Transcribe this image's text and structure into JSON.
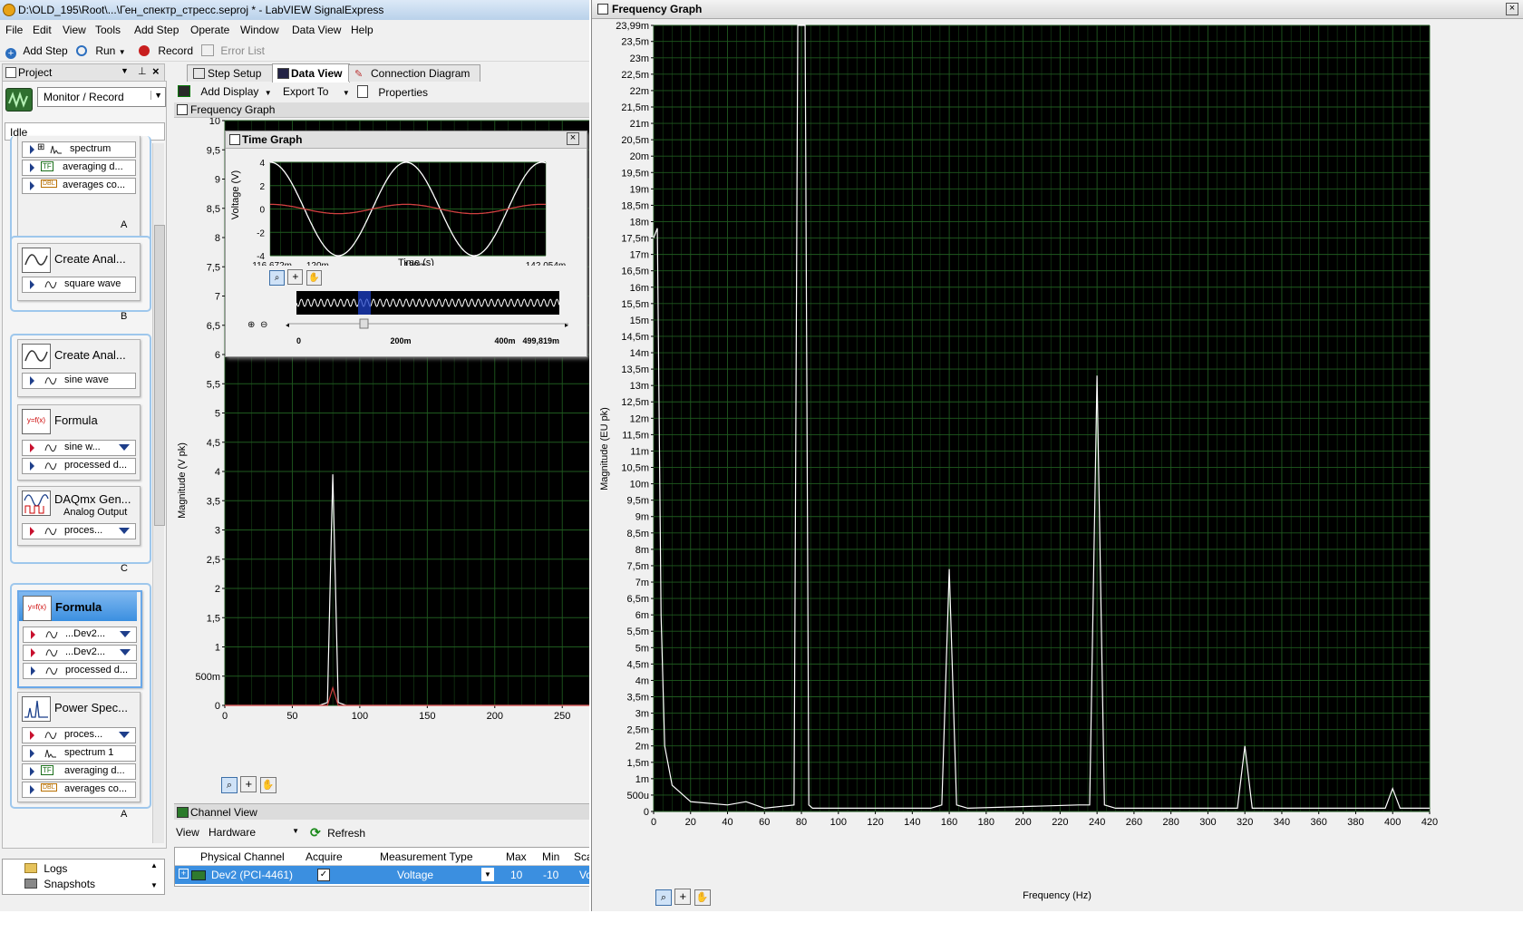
{
  "window": {
    "title": "D:\\OLD_195\\Root\\...\\Ген_спектр_стресс.seproj * - LabVIEW SignalExpress"
  },
  "menu": [
    "File",
    "Edit",
    "View",
    "Tools",
    "Add Step",
    "Operate",
    "Window",
    "Data View",
    "Help"
  ],
  "toolbar": {
    "add_step": "Add Step",
    "run": "Run",
    "record": "Record",
    "error_list": "Error List"
  },
  "project": {
    "title": "Project",
    "mode": "Monitor / Record",
    "status": "Idle",
    "groups": [
      {
        "letter": "A",
        "rows": [
          "spectrum",
          "averaging d...",
          "averages co..."
        ]
      },
      {
        "letter": "B",
        "title": "Create Anal...",
        "rows": [
          "square wave"
        ]
      },
      {
        "letter": "C",
        "steps": [
          {
            "title": "Create Anal...",
            "rows": [
              "sine wave"
            ]
          },
          {
            "title": "Formula",
            "rows": [
              "sine w...",
              "processed d..."
            ]
          },
          {
            "title": "DAQmx Gen...",
            "subtitle": "Analog Output",
            "rows": [
              "proces..."
            ]
          }
        ]
      },
      {
        "letter": "A",
        "steps": [
          {
            "title": "Formula",
            "rows": [
              "...Dev2...",
              "...Dev2...",
              "processed d..."
            ]
          },
          {
            "title": "Power Spec...",
            "rows": [
              "proces...",
              "spectrum 1",
              "averaging d...",
              "averages co..."
            ]
          }
        ]
      }
    ],
    "logs": "Logs",
    "snapshots": "Snapshots"
  },
  "tabs": {
    "step_setup": "Step Setup",
    "data_view": "Data View",
    "connection_diagram": "Connection Diagram"
  },
  "dataview_toolbar": {
    "add_display": "Add Display",
    "export_to": "Export To",
    "properties": "Properties"
  },
  "small_freq": {
    "title": "Frequency Graph",
    "ylabel": "Magnitude (V pk)",
    "yticks": [
      "0",
      "500m",
      "1",
      "1,5",
      "2",
      "2,5",
      "3",
      "3,5",
      "4",
      "4,5",
      "5",
      "5,5",
      "6",
      "6,5",
      "7",
      "7,5",
      "8",
      "8,5",
      "9",
      "9,5",
      "10"
    ],
    "xticks": [
      "0",
      "50",
      "100",
      "150",
      "200",
      "250"
    ]
  },
  "time_graph": {
    "title": "Time Graph",
    "ylabel": "Voltage (V)",
    "xlabel": "Time (s)",
    "yticks": [
      "4",
      "2",
      "0",
      "-2",
      "-4"
    ],
    "xticks": [
      "116,672m",
      "120m",
      "130m",
      "142,054m"
    ],
    "overview_ticks": [
      "0",
      "200m",
      "400m",
      "499,819m"
    ]
  },
  "channel_view": {
    "title": "Channel View",
    "view_label": "View",
    "view_value": "Hardware",
    "refresh": "Refresh",
    "columns": [
      "Physical Channel",
      "Acquire",
      "Measurement Type",
      "Max",
      "Min",
      "Sca"
    ],
    "row": {
      "channel": "Dev2 (PCI-4461)",
      "acquire": "✓",
      "type": "Voltage",
      "max": "10",
      "min": "-10",
      "sca": "Vo"
    }
  },
  "freq_graph": {
    "title": "Frequency Graph",
    "ylabel": "Magnitude (EU pk)",
    "xlabel": "Frequency (Hz)",
    "yticks": [
      "0",
      "500u",
      "1m",
      "1,5m",
      "2m",
      "2,5m",
      "3m",
      "3,5m",
      "4m",
      "4,5m",
      "5m",
      "5,5m",
      "6m",
      "6,5m",
      "7m",
      "7,5m",
      "8m",
      "8,5m",
      "9m",
      "9,5m",
      "10m",
      "10,5m",
      "11m",
      "11,5m",
      "12m",
      "12,5m",
      "13m",
      "13,5m",
      "14m",
      "14,5m",
      "15m",
      "15,5m",
      "16m",
      "16,5m",
      "17m",
      "17,5m",
      "18m",
      "18,5m",
      "19m",
      "19,5m",
      "20m",
      "20,5m",
      "21m",
      "21,5m",
      "22m",
      "22,5m",
      "23m",
      "23,5m",
      "23,99m"
    ],
    "xticks": [
      "0",
      "20",
      "40",
      "60",
      "80",
      "100",
      "120",
      "140",
      "160",
      "180",
      "200",
      "220",
      "240",
      "260",
      "280",
      "300",
      "320",
      "340",
      "360",
      "380",
      "400",
      "420"
    ]
  },
  "chart_data": [
    {
      "type": "line",
      "title": "Frequency Graph",
      "xlabel": "Frequency (Hz)",
      "ylabel": "Magnitude (EU pk)",
      "xlim": [
        0,
        420
      ],
      "ylim": [
        0,
        0.02399
      ],
      "series": [
        {
          "x": [
            0,
            2,
            4,
            6,
            10,
            20,
            40,
            50,
            60,
            76,
            78,
            80,
            82,
            84,
            86,
            100,
            150,
            156,
            160,
            164,
            170,
            230,
            236,
            240,
            244,
            250,
            316,
            320,
            324,
            330,
            396,
            400,
            404,
            420
          ],
          "y": [
            0.0175,
            0.0178,
            0.006,
            0.002,
            0.0008,
            0.0003,
            0.0002,
            0.0003,
            0.0001,
            0.0002,
            0.024,
            0.024,
            0.024,
            0.0002,
            0.0001,
            0.0001,
            0.0001,
            0.0002,
            0.0074,
            0.0002,
            0.0001,
            0.0002,
            0.0002,
            0.0133,
            0.0002,
            0.0001,
            0.0001,
            0.002,
            0.0001,
            0.0001,
            0.0001,
            0.0007,
            0.0001,
            0.0001
          ]
        }
      ]
    },
    {
      "type": "line",
      "title": "Frequency Graph",
      "xlabel": "",
      "ylabel": "Magnitude (V pk)",
      "xlim": [
        0,
        270
      ],
      "ylim": [
        0,
        10
      ],
      "series": [
        {
          "x": [
            0,
            70,
            76,
            79,
            80,
            81,
            84,
            90,
            270
          ],
          "y": [
            0,
            0,
            0.05,
            3.0,
            3.95,
            3.0,
            0.05,
            0,
            0
          ]
        },
        {
          "x": [
            0,
            76,
            80,
            84,
            270
          ],
          "y": [
            0,
            0,
            0.3,
            0,
            0
          ]
        }
      ]
    },
    {
      "type": "line",
      "title": "Time Graph",
      "xlabel": "Time (s)",
      "ylabel": "Voltage (V)",
      "xlim": [
        0.116672,
        0.142054
      ],
      "ylim": [
        -4,
        4
      ],
      "series": [
        {
          "amplitude": 4,
          "frequency": 80,
          "color": "#ffffff"
        },
        {
          "amplitude": 0.4,
          "frequency": 80,
          "color": "#d04040"
        }
      ]
    }
  ],
  "colors": {
    "plot_bg": "#000000",
    "grid": "#1f5a1f",
    "trace": "#ffffff",
    "trace2": "#d04040",
    "highlight": "#3b8fe0"
  }
}
